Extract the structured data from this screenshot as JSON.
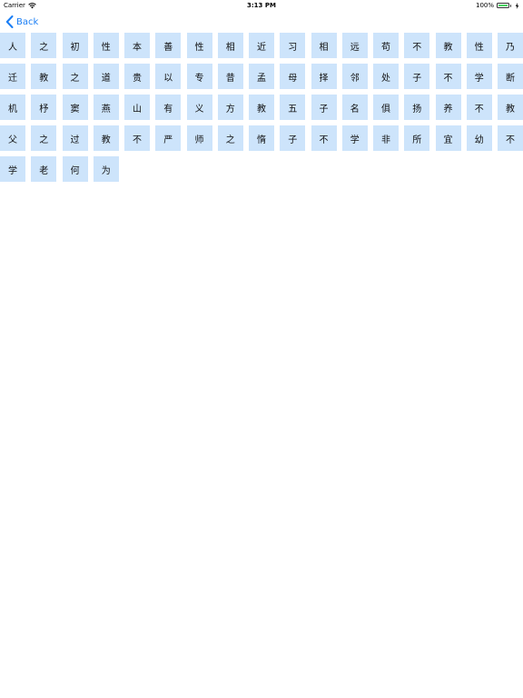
{
  "status_bar": {
    "carrier": "Carrier",
    "time": "3:13 PM",
    "battery_text": "100%",
    "battery_level": 1.0,
    "battery_color": "#4cd964"
  },
  "nav": {
    "back_label": "Back",
    "accent": "#1a7ef5"
  },
  "grid": {
    "cell_color": "#cde4fb",
    "chars": [
      "人",
      "之",
      "初",
      "性",
      "本",
      "善",
      "性",
      "相",
      "近",
      "习",
      "相",
      "远",
      "苟",
      "不",
      "教",
      "性",
      "乃",
      "迁",
      "教",
      "之",
      "道",
      "贵",
      "以",
      "专",
      "昔",
      "孟",
      "母",
      "择",
      "邻",
      "处",
      "子",
      "不",
      "学",
      "断",
      "机",
      "杼",
      "窦",
      "燕",
      "山",
      "有",
      "义",
      "方",
      "教",
      "五",
      "子",
      "名",
      "俱",
      "扬",
      "养",
      "不",
      "教",
      "父",
      "之",
      "过",
      "教",
      "不",
      "严",
      "师",
      "之",
      "惰",
      "子",
      "不",
      "学",
      "非",
      "所",
      "宜",
      "幼",
      "不",
      "学",
      "老",
      "何",
      "为"
    ]
  }
}
